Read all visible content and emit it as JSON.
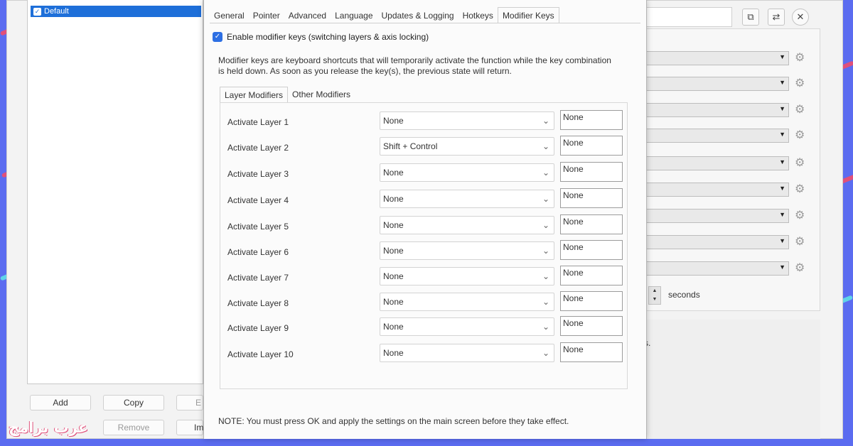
{
  "profiles": {
    "items": [
      {
        "label": "Default",
        "selected": true
      }
    ],
    "buttons": {
      "add": "Add",
      "copy": "Copy",
      "remove": "Remove",
      "edit_partial": "E",
      "import_partial": "Im"
    }
  },
  "right_panel": {
    "seconds_label": "seconds",
    "stub_text": "s."
  },
  "dialog": {
    "tabs": [
      {
        "label": "General"
      },
      {
        "label": "Pointer"
      },
      {
        "label": "Advanced"
      },
      {
        "label": "Language"
      },
      {
        "label": "Updates & Logging"
      },
      {
        "label": "Hotkeys"
      },
      {
        "label": "Modifier Keys",
        "active": true
      }
    ],
    "enable_checkbox_label": "Enable modifier keys (switching layers & axis locking)",
    "enable_checked": true,
    "description": "Modifier keys are keyboard shortcuts that will temporarily activate the function while the key combination is held down. As soon as you release the key(s), the previous state will return.",
    "subtabs": [
      {
        "label": "Layer Modifiers",
        "active": true
      },
      {
        "label": "Other Modifiers"
      }
    ],
    "layers": [
      {
        "label": "Activate Layer 1",
        "modifier": "None",
        "key": "None"
      },
      {
        "label": "Activate Layer 2",
        "modifier": "Shift + Control",
        "key": "None"
      },
      {
        "label": "Activate Layer 3",
        "modifier": "None",
        "key": "None"
      },
      {
        "label": "Activate Layer 4",
        "modifier": "None",
        "key": "None"
      },
      {
        "label": "Activate Layer 5",
        "modifier": "None",
        "key": "None"
      },
      {
        "label": "Activate Layer 6",
        "modifier": "None",
        "key": "None"
      },
      {
        "label": "Activate Layer 7",
        "modifier": "None",
        "key": "None"
      },
      {
        "label": "Activate Layer 8",
        "modifier": "None",
        "key": "None"
      },
      {
        "label": "Activate Layer 9",
        "modifier": "None",
        "key": "None"
      },
      {
        "label": "Activate Layer 10",
        "modifier": "None",
        "key": "None"
      }
    ],
    "note": "NOTE: You must press OK and apply the settings on the main screen before they take effect."
  },
  "watermark": "عرب برامج",
  "colors": {
    "accent": "#2d6fe3",
    "background": "#5b6cf0",
    "selection": "#1e6fd9"
  },
  "icons": [
    "copy-icon",
    "swap-icon",
    "close-circle-icon",
    "gear-icon",
    "chevron-down-icon",
    "checkmark-icon"
  ]
}
